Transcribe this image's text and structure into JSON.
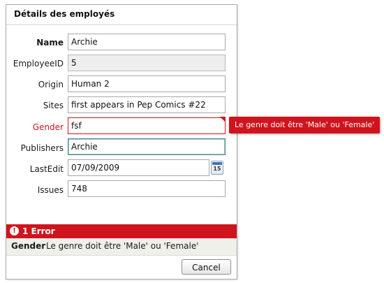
{
  "panel": {
    "title": "Détails des employés"
  },
  "form": {
    "name": {
      "label": "Name",
      "value": "Archie"
    },
    "employee_id": {
      "label": "EmployeeID",
      "value": "5"
    },
    "origin": {
      "label": "Origin",
      "value": "Human 2"
    },
    "sites": {
      "label": "Sites",
      "value": "first appears in Pep Comics #22"
    },
    "gender": {
      "label": "Gender",
      "value": "fsf"
    },
    "publishers": {
      "label": "Publishers",
      "value": "Archie"
    },
    "last_edit": {
      "label": "LastEdit",
      "value": "07/09/2009"
    },
    "issues": {
      "label": "Issues",
      "value": "748"
    }
  },
  "calendar_button": {
    "icon": "calendar-icon",
    "day": "15"
  },
  "validation": {
    "tooltip": "Le genre doit être 'Male' ou 'Female'",
    "summary_icon": "!",
    "summary_title": "1 Error",
    "errors": [
      {
        "field": "Gender",
        "message": "Le genre doit être 'Male' ou 'Female'"
      }
    ]
  },
  "buttons": {
    "cancel": "Cancel"
  },
  "colors": {
    "error": "#d0141e",
    "focus_border": "#56828f",
    "readonly_bg": "#eeeeee",
    "summary_row_bg": "#f0f0ea"
  }
}
